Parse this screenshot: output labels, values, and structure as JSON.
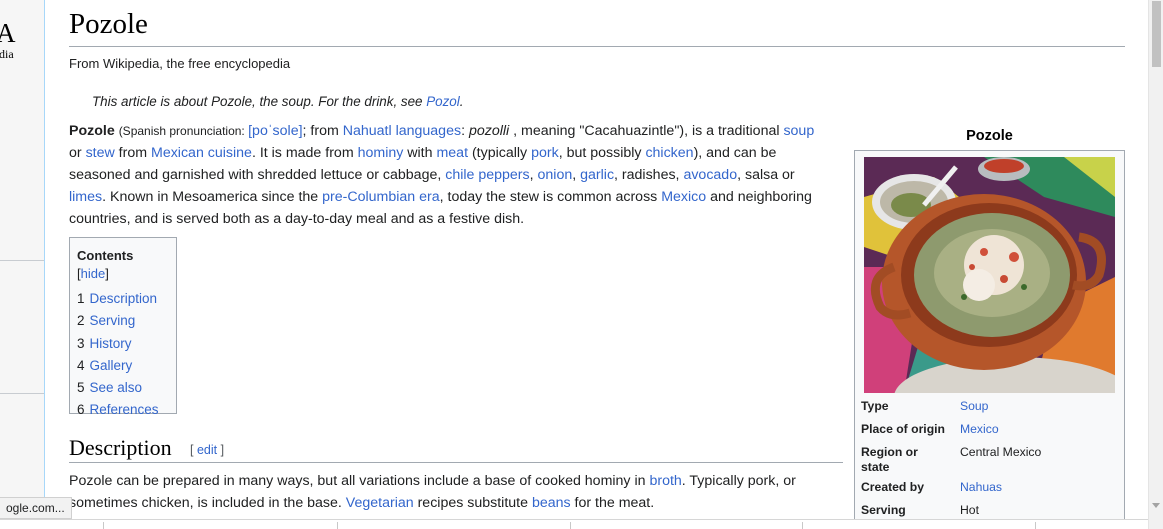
{
  "sidebar": {
    "logo_letter": "A",
    "logo_tag": "dia"
  },
  "article": {
    "title": "Pozole",
    "tagline": "From Wikipedia, the free encyclopedia",
    "hatnote": {
      "prefix": "This article is about Pozole, the soup. For the drink, see ",
      "link": "Pozol",
      "suffix": "."
    },
    "lead": {
      "bold_term": "Pozole",
      "pron_label": "(Spanish pronunciation: ",
      "ipa": "[poˈsole]",
      "t1": "; from ",
      "nahuatl_link": "Nahuatl languages",
      "t2": ": ",
      "pozoll": "pozolli",
      "t3": " , meaning \"Cacahuazintle\"), is a traditional ",
      "soup": "soup",
      "t4": " or ",
      "stew": "stew",
      "t5": " from ",
      "mexican_cuisine": "Mexican cuisine",
      "t6": ". It is made from ",
      "hominy": "hominy",
      "t7": " with ",
      "meat": "meat",
      "t8": " (typically ",
      "pork": "pork",
      "t9": ", but possibly ",
      "chicken": "chicken",
      "t10": "), and can be seasoned and garnished with shredded lettuce or cabbage, ",
      "chile_peppers": "chile peppers",
      "c1": ", ",
      "onion": "onion",
      "c2": ", ",
      "garlic": "garlic",
      "t11": ", radishes, ",
      "avocado": "avocado",
      "t12": ", salsa or ",
      "limes": "limes",
      "t13": ". Known in Mesoamerica since the ",
      "pre_columbian": "pre-Columbian era",
      "t14": ", today the stew is common across ",
      "mexico": "Mexico",
      "t15": " and neighboring countries, and is served both as a day-to-day meal and as a festive dish."
    },
    "toc": {
      "title": "Contents",
      "hide_label": "hide",
      "items": [
        {
          "num": "1",
          "label": "Description"
        },
        {
          "num": "2",
          "label": "Serving"
        },
        {
          "num": "3",
          "label": "History"
        },
        {
          "num": "4",
          "label": "Gallery"
        },
        {
          "num": "5",
          "label": "See also"
        },
        {
          "num": "6",
          "label": "References"
        }
      ]
    },
    "description": {
      "heading": "Description",
      "edit_label": "edit",
      "p1": "Pozole can be prepared in many ways, but all variations include a base of cooked hominy in ",
      "broth": "broth",
      "p2": ". Typically pork, or sometimes chicken, is included in the base. ",
      "vegetarian": "Vegetarian",
      "p3": " recipes substitute ",
      "beans": "beans",
      "p4": " for the meat."
    }
  },
  "infobox": {
    "title": "Pozole",
    "rows": [
      {
        "label": "Type",
        "value": "Soup",
        "is_link": true
      },
      {
        "label": "Place of origin",
        "value": "Mexico",
        "is_link": true
      },
      {
        "label": "Region or state",
        "value": "Central Mexico",
        "is_link": false
      },
      {
        "label": "Created by",
        "value": "Nahuas",
        "is_link": true
      },
      {
        "label": "Serving",
        "value": "Hot",
        "is_link": false
      }
    ]
  },
  "status_url": "ogle.com...",
  "colors": {
    "link": "#3366cc",
    "text": "#202122",
    "infobox_bg": "#f8f9fa",
    "border": "#a2a9b1"
  }
}
